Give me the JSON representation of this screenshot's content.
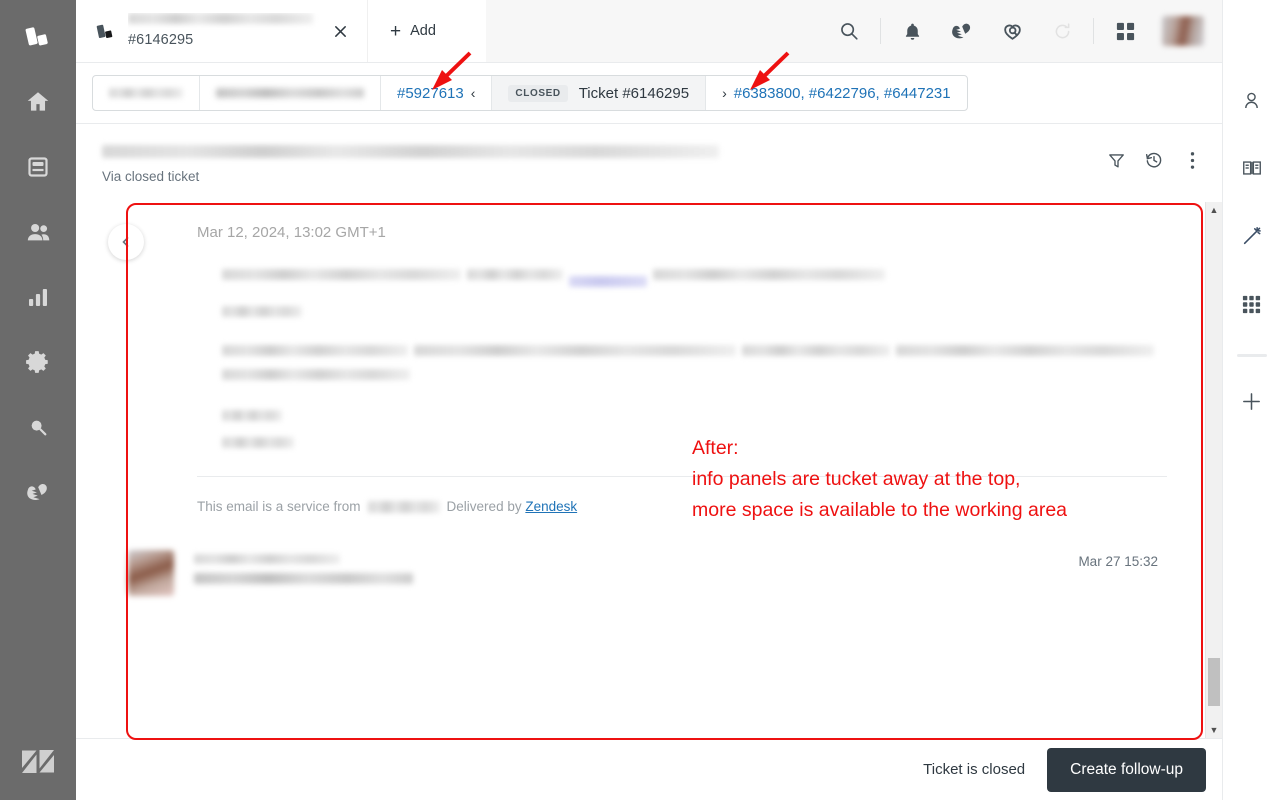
{
  "app": {
    "brand": "Zendesk",
    "accent_blue": "#1f73b7",
    "annotation_red": "#ee1111",
    "dark_button": "#2f3941"
  },
  "sidebar": {
    "items": [
      {
        "name": "home-icon",
        "label": "Home"
      },
      {
        "name": "views-icon",
        "label": "Views"
      },
      {
        "name": "customers-icon",
        "label": "Customers"
      },
      {
        "name": "reporting-icon",
        "label": "Reporting"
      },
      {
        "name": "admin-gear-icon",
        "label": "Admin"
      },
      {
        "name": "search-icon",
        "label": "Search"
      },
      {
        "name": "explore-heart-icon",
        "label": "Explore"
      }
    ],
    "logo_label": "Zendesk"
  },
  "tabbar": {
    "active_tab": {
      "title_redacted": "",
      "ticket_id": "#6146295",
      "icon": "ticket-icon",
      "close_icon": "close-icon"
    },
    "add_tab": {
      "plus": "+",
      "label": "Add"
    },
    "actions": [
      {
        "name": "search-icon",
        "label": "Search"
      },
      {
        "name": "bell-icon",
        "label": "Notifications"
      },
      {
        "name": "guide-heart-icon",
        "label": "Guide"
      },
      {
        "name": "explore-q-icon",
        "label": "Explore"
      },
      {
        "name": "refresh-icon",
        "label": "Refresh"
      },
      {
        "name": "apps-grid-icon",
        "label": "Products"
      },
      {
        "name": "avatar",
        "label": "Profile"
      }
    ]
  },
  "breadcrumb": {
    "segment_1_redacted": "",
    "segment_2_redacted": "",
    "prev_ticket": {
      "label": "#5927613",
      "chevron": "‹"
    },
    "current": {
      "badge": "CLOSED",
      "label": "Ticket #6146295"
    },
    "next_tickets": {
      "chevron": "›",
      "label": "#6383800, #6422796, #6447231"
    }
  },
  "ticket": {
    "subject_redacted": "",
    "via": "Via closed ticket",
    "head_actions": [
      {
        "name": "filter-icon",
        "label": "Filter"
      },
      {
        "name": "history-icon",
        "label": "Events"
      },
      {
        "name": "more-menu-icon",
        "label": "More"
      }
    ]
  },
  "conversation": {
    "event_date": "Mar 12, 2024, 13:02 GMT+1",
    "email_footer": {
      "prefix": "This email is a service from",
      "redacted": "",
      "middle": "Delivered by",
      "link": "Zendesk"
    },
    "next_comment": {
      "author_redacted": "",
      "date": "Mar 27 15:32"
    },
    "collapse_handle_icon": "chevron-left-icon",
    "scrollbar": {
      "up": "▲",
      "down": "▼"
    }
  },
  "bottombar": {
    "status_text": "Ticket is closed",
    "primary_button": "Create follow-up"
  },
  "rightrail": {
    "items": [
      {
        "name": "user-icon",
        "label": "Customer context"
      },
      {
        "name": "knowledge-book-icon",
        "label": "Knowledge"
      },
      {
        "name": "magic-wand-icon",
        "label": "AI assist"
      },
      {
        "name": "apps-dots-icon",
        "label": "Apps"
      },
      {
        "name": "add-app-icon",
        "label": "Add"
      }
    ]
  },
  "annotations": {
    "heading": "After:",
    "line2": "info panels are tucket away at the top,",
    "line3": "more space is available to the working area"
  }
}
